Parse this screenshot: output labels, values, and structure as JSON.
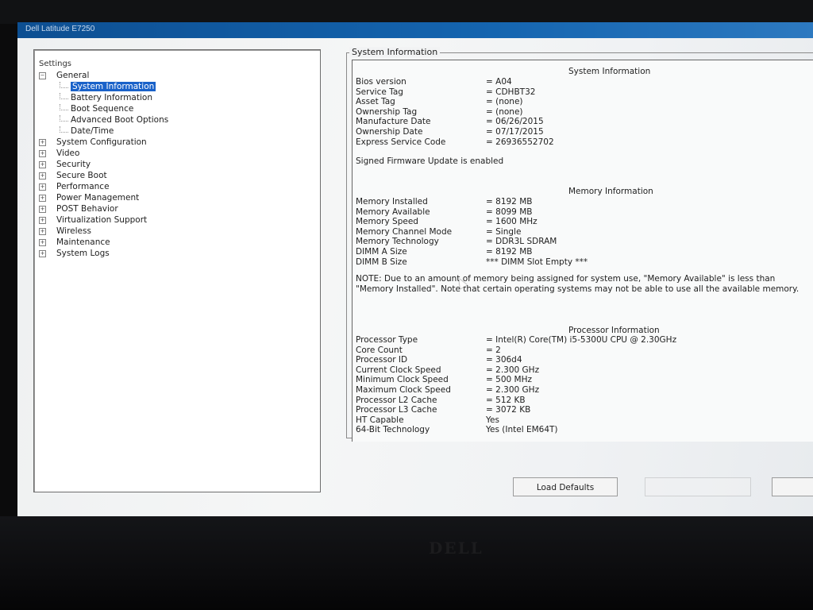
{
  "window": {
    "title": "Dell Latitude E7250"
  },
  "tree": {
    "root": "Settings",
    "items": [
      {
        "label": "General",
        "expander": "−",
        "level": 0
      },
      {
        "label": "System Information",
        "level": 1,
        "selected": true
      },
      {
        "label": "Battery Information",
        "level": 1
      },
      {
        "label": "Boot Sequence",
        "level": 1
      },
      {
        "label": "Advanced Boot Options",
        "level": 1
      },
      {
        "label": "Date/Time",
        "level": 1
      },
      {
        "label": "System Configuration",
        "expander": "+",
        "level": 0
      },
      {
        "label": "Video",
        "expander": "+",
        "level": 0
      },
      {
        "label": "Security",
        "expander": "+",
        "level": 0
      },
      {
        "label": "Secure Boot",
        "expander": "+",
        "level": 0
      },
      {
        "label": "Performance",
        "expander": "+",
        "level": 0
      },
      {
        "label": "Power Management",
        "expander": "+",
        "level": 0
      },
      {
        "label": "POST Behavior",
        "expander": "+",
        "level": 0
      },
      {
        "label": "Virtualization Support",
        "expander": "+",
        "level": 0
      },
      {
        "label": "Wireless",
        "expander": "+",
        "level": 0
      },
      {
        "label": "Maintenance",
        "expander": "+",
        "level": 0
      },
      {
        "label": "System Logs",
        "expander": "+",
        "level": 0
      }
    ]
  },
  "panel": {
    "group_title": "System Information",
    "system": {
      "title": "System Information",
      "rows": [
        {
          "k": "Bios version",
          "v": "= A04"
        },
        {
          "k": "Service Tag",
          "v": "= CDHBT32"
        },
        {
          "k": "Asset Tag",
          "v": "= (none)"
        },
        {
          "k": "Ownership Tag",
          "v": "= (none)"
        },
        {
          "k": "Manufacture Date",
          "v": "= 06/26/2015"
        },
        {
          "k": "Ownership Date",
          "v": "= 07/17/2015"
        },
        {
          "k": "Express Service Code",
          "v": "= 26936552702"
        }
      ],
      "firmware_note": "Signed Firmware Update is enabled"
    },
    "memory": {
      "title": "Memory Information",
      "rows": [
        {
          "k": "Memory Installed",
          "v": "= 8192 MB"
        },
        {
          "k": "Memory Available",
          "v": "= 8099 MB"
        },
        {
          "k": "Memory Speed",
          "v": "= 1600 MHz"
        },
        {
          "k": "Memory Channel Mode",
          "v": "= Single"
        },
        {
          "k": "Memory Technology",
          "v": "= DDR3L SDRAM"
        },
        {
          "k": "DIMM A Size",
          "v": "= 8192 MB"
        },
        {
          "k": "DIMM B Size",
          "v": "*** DIMM Slot Empty ***"
        }
      ],
      "note": "NOTE: Due to an amount of memory being assigned for system use, \"Memory Available\" is less than \"Memory Installed\". Note that certain operating systems may not be able to use all the available memory."
    },
    "processor": {
      "title": "Processor Information",
      "rows": [
        {
          "k": "Processor Type",
          "v": "= Intel(R) Core(TM) i5-5300U CPU @ 2.30GHz"
        },
        {
          "k": "Core Count",
          "v": "= 2"
        },
        {
          "k": "Processor ID",
          "v": "= 306d4"
        },
        {
          "k": "Current Clock Speed",
          "v": "= 2.300 GHz"
        },
        {
          "k": "Minimum Clock Speed",
          "v": "= 500 MHz"
        },
        {
          "k": "Maximum Clock Speed",
          "v": "= 2.300 GHz"
        },
        {
          "k": "Processor L2 Cache",
          "v": "= 512 KB"
        },
        {
          "k": "Processor L3 Cache",
          "v": "= 3072 KB"
        },
        {
          "k": "HT Capable",
          "v": "Yes"
        },
        {
          "k": "64-Bit Technology",
          "v": "Yes (Intel EM64T)"
        }
      ]
    }
  },
  "buttons": {
    "load_defaults": "Load Defaults",
    "apply": "",
    "exit": ""
  },
  "bezel": {
    "logo": "DELL"
  },
  "colors": {
    "title_bar": "#1565b0",
    "selection": "#1a62c9"
  }
}
